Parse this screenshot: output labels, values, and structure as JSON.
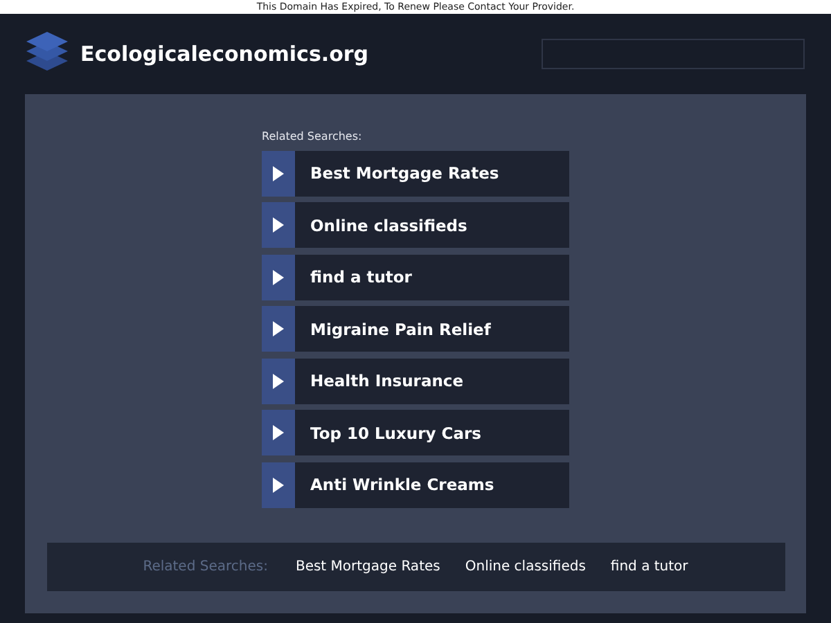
{
  "notice": "This Domain Has Expired, To Renew Please Contact Your Provider.",
  "header": {
    "site_name": "Ecologicaleconomics.org"
  },
  "related": {
    "label": "Related Searches:",
    "links": [
      {
        "text": "Best Mortgage Rates"
      },
      {
        "text": "Online classifieds"
      },
      {
        "text": "find a tutor"
      },
      {
        "text": "Migraine Pain Relief"
      },
      {
        "text": "Health Insurance"
      },
      {
        "text": "Top 10 Luxury Cars"
      },
      {
        "text": "Anti Wrinkle Creams"
      }
    ]
  },
  "footer": {
    "label": "Related Searches:",
    "links": [
      {
        "text": "Best Mortgage Rates"
      },
      {
        "text": "Online classifieds"
      },
      {
        "text": "find a tutor"
      }
    ]
  }
}
